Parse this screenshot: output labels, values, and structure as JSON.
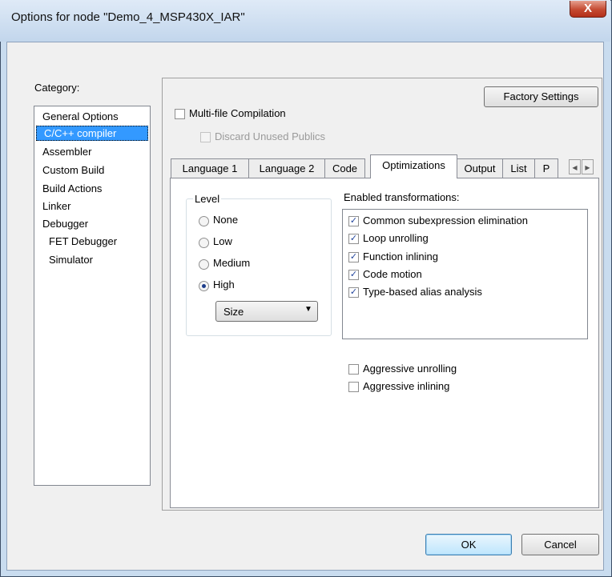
{
  "window": {
    "title": "Options for node \"Demo_4_MSP430X_IAR\"",
    "close_glyph": "X"
  },
  "category": {
    "label": "Category:",
    "items": [
      {
        "label": "General Options",
        "selected": false
      },
      {
        "label": "C/C++ compiler",
        "selected": true
      },
      {
        "label": "Assembler",
        "selected": false
      },
      {
        "label": "Custom Build",
        "selected": false
      },
      {
        "label": "Build Actions",
        "selected": false
      },
      {
        "label": "Linker",
        "selected": false
      },
      {
        "label": "Debugger",
        "selected": false
      },
      {
        "label": "FET Debugger",
        "selected": false
      },
      {
        "label": "Simulator",
        "selected": false
      }
    ]
  },
  "panel": {
    "factory_settings": "Factory Settings",
    "multi_file": {
      "label": "Multi-file Compilation",
      "checked": false
    },
    "discard_unused": {
      "label": "Discard Unused Publics",
      "checked": false,
      "disabled": true
    }
  },
  "tabs": [
    {
      "label": "Language 1",
      "active": false
    },
    {
      "label": "Language 2",
      "active": false
    },
    {
      "label": "Code",
      "active": false
    },
    {
      "label": "Optimizations",
      "active": true
    },
    {
      "label": "Output",
      "active": false
    },
    {
      "label": "List",
      "active": false
    },
    {
      "label": "P",
      "active": false
    }
  ],
  "scroll_arrows": {
    "left": "◀",
    "right": "▶"
  },
  "optimizations": {
    "level_label": "Level",
    "levels": [
      {
        "label": "None",
        "selected": false
      },
      {
        "label": "Low",
        "selected": false
      },
      {
        "label": "Medium",
        "selected": false
      },
      {
        "label": "High",
        "selected": true
      }
    ],
    "size_select": {
      "value": "Size",
      "arrow": "▼"
    },
    "transformations_label": "Enabled transformations:",
    "transformations": [
      {
        "label": "Common subexpression elimination",
        "checked": true
      },
      {
        "label": "Loop unrolling",
        "checked": true
      },
      {
        "label": "Function inlining",
        "checked": true
      },
      {
        "label": "Code motion",
        "checked": true
      },
      {
        "label": "Type-based alias analysis",
        "checked": true
      }
    ],
    "aggressive_unrolling": {
      "label": "Aggressive unrolling",
      "checked": false
    },
    "aggressive_inlining": {
      "label": "Aggressive inlining",
      "checked": false
    }
  },
  "buttons": {
    "ok": "OK",
    "cancel": "Cancel"
  },
  "check_glyph": "✓"
}
